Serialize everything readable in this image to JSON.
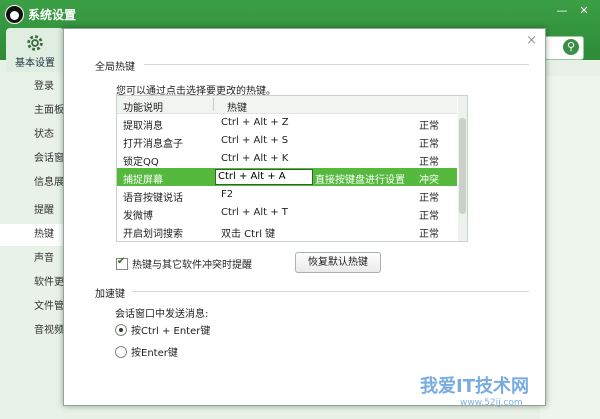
{
  "window": {
    "title": "系统设置",
    "controls": [
      "—",
      "✕"
    ]
  },
  "nav": {
    "basic_label": "基本设置"
  },
  "search": {
    "placeholder": ""
  },
  "sidebar": {
    "items": [
      {
        "label": "登录"
      },
      {
        "label": "主面板"
      },
      {
        "label": "状态"
      },
      {
        "label": "会话窗口"
      },
      {
        "label": "信息展示"
      },
      {
        "label": "提醒"
      },
      {
        "label": "热键"
      },
      {
        "label": "声音"
      },
      {
        "label": "软件更新"
      },
      {
        "label": "文件管理"
      },
      {
        "label": "音视频"
      }
    ],
    "active_index": 6
  },
  "dialog": {
    "close": "×",
    "global_hotkey": {
      "title": "全局热键",
      "hint": "您可以通过点击选择要更改的热键。",
      "columns": [
        "功能说明",
        "热键"
      ],
      "rows": [
        {
          "func": "提取消息",
          "key": "Ctrl + Alt + Z",
          "status": "正常"
        },
        {
          "func": "打开消息盒子",
          "key": "Ctrl + Alt + S",
          "status": "正常"
        },
        {
          "func": "锁定QQ",
          "key": "Ctrl + Alt + K",
          "status": "正常"
        },
        {
          "func": "捕捉屏幕",
          "key": "Ctrl + Alt + A",
          "status": "冲突",
          "note": "直接按键盘进行设置"
        },
        {
          "func": "语音按键说话",
          "key": "F2",
          "status": "正常"
        },
        {
          "func": "发微博",
          "key": "Ctrl + Alt + T",
          "status": "正常"
        },
        {
          "func": "开启划词搜索",
          "key": "双击 Ctrl 键",
          "status": "正常"
        }
      ],
      "conflict_checkbox": "热键与其它软件冲突时提醒",
      "restore_button": "恢复默认热键"
    },
    "accel": {
      "title": "加速键",
      "subtitle": "会话窗口中发送消息:",
      "options": [
        "按Ctrl + Enter键",
        "按Enter键"
      ],
      "selected": 0
    }
  },
  "watermark": {
    "main": "我爱IT技术网",
    "sub": "www.52ij.com"
  }
}
